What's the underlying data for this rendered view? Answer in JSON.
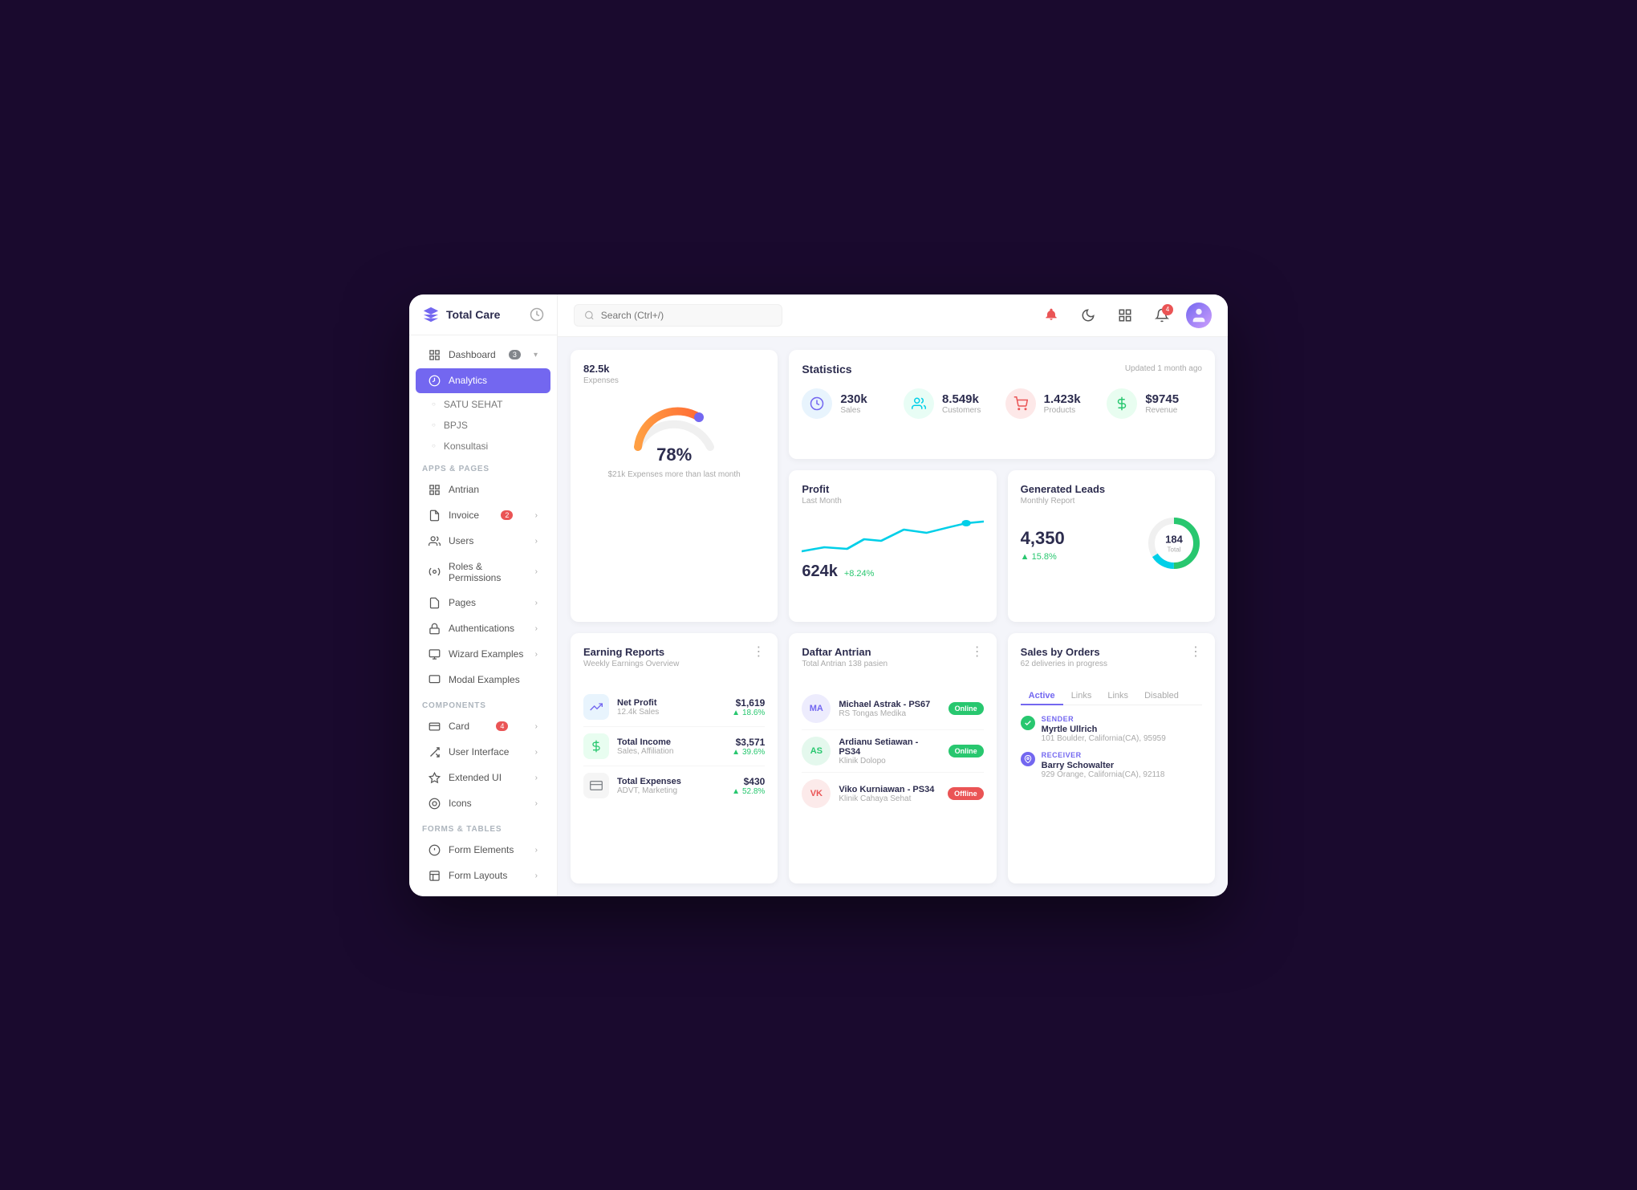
{
  "app": {
    "title": "Total Care",
    "search_placeholder": "Search (Ctrl+/)"
  },
  "sidebar": {
    "sections": [
      {
        "label": "",
        "items": [
          {
            "id": "dashboard",
            "label": "Dashboard",
            "icon": "home",
            "badge": "3",
            "badge_color": "gray",
            "has_arrow": true,
            "active": false
          },
          {
            "id": "analytics",
            "label": "Analytics",
            "icon": "bar-chart",
            "active": true
          },
          {
            "id": "satu-sehat",
            "label": "SATU SEHAT",
            "icon": "dot",
            "sub": true,
            "active": false
          },
          {
            "id": "bpjs",
            "label": "BPJS",
            "icon": "dot",
            "sub": true,
            "active": false
          },
          {
            "id": "konsultasi",
            "label": "Konsultasi",
            "icon": "dot",
            "sub": true,
            "active": false
          }
        ]
      },
      {
        "label": "APPS & PAGES",
        "items": [
          {
            "id": "antrian",
            "label": "Antrian",
            "icon": "grid",
            "active": false
          },
          {
            "id": "invoice",
            "label": "Invoice",
            "icon": "file",
            "badge": "2",
            "badge_color": "red",
            "has_arrow": true,
            "active": false
          },
          {
            "id": "users",
            "label": "Users",
            "icon": "users",
            "has_arrow": true,
            "active": false
          },
          {
            "id": "roles",
            "label": "Roles & Permissions",
            "icon": "gear",
            "has_arrow": true,
            "active": false
          },
          {
            "id": "pages",
            "label": "Pages",
            "icon": "pages",
            "has_arrow": true,
            "active": false
          },
          {
            "id": "auth",
            "label": "Authentications",
            "icon": "lock",
            "has_arrow": true,
            "active": false
          },
          {
            "id": "wizard",
            "label": "Wizard Examples",
            "icon": "wizard",
            "has_arrow": true,
            "active": false
          },
          {
            "id": "modal",
            "label": "Modal Examples",
            "icon": "modal",
            "active": false
          }
        ]
      },
      {
        "label": "COMPONENTS",
        "items": [
          {
            "id": "card",
            "label": "Card",
            "icon": "card",
            "badge": "4",
            "badge_color": "red",
            "has_arrow": true,
            "active": false
          },
          {
            "id": "ui",
            "label": "User Interface",
            "icon": "ui",
            "has_arrow": true,
            "active": false
          },
          {
            "id": "extended",
            "label": "Extended UI",
            "icon": "extended",
            "has_arrow": true,
            "active": false
          },
          {
            "id": "icons",
            "label": "Icons",
            "icon": "icons",
            "has_arrow": true,
            "active": false
          }
        ]
      },
      {
        "label": "FORMS & TABLES",
        "items": [
          {
            "id": "form-elements",
            "label": "Form Elements",
            "icon": "form",
            "has_arrow": true,
            "active": false
          },
          {
            "id": "form-layouts",
            "label": "Form Layouts",
            "icon": "layout",
            "has_arrow": true,
            "active": false
          }
        ]
      }
    ]
  },
  "header": {
    "notif_count": "4"
  },
  "statistics": {
    "title": "Statistics",
    "updated": "Updated 1 month ago",
    "items": [
      {
        "value": "230k",
        "label": "Sales",
        "color": "blue"
      },
      {
        "value": "8.549k",
        "label": "Customers",
        "color": "teal"
      },
      {
        "value": "1.423k",
        "label": "Products",
        "color": "red"
      },
      {
        "value": "$9745",
        "label": "Revenue",
        "color": "green"
      }
    ]
  },
  "expense": {
    "title": "82.5k",
    "subtitle": "Expenses",
    "percent": "78%",
    "note": "$21k Expenses more than last month"
  },
  "profit": {
    "title": "Profit",
    "subtitle": "Last Month",
    "value": "624k",
    "change": "+8.24%"
  },
  "leads": {
    "title": "Generated Leads",
    "subtitle": "Monthly Report",
    "value": "4,350",
    "change": "15.8%",
    "donut_total": "184",
    "donut_label": "Total"
  },
  "earning": {
    "title": "Earning Reports",
    "subtitle": "Weekly Earnings Overview",
    "items": [
      {
        "name": "Net Profit",
        "sub": "12.4k Sales",
        "amount": "$1,619",
        "change": "18.6%",
        "color": "blue"
      },
      {
        "name": "Total Income",
        "sub": "Sales, Affiliation",
        "amount": "$3,571",
        "change": "39.6%",
        "color": "green"
      },
      {
        "name": "Total Expenses",
        "sub": "ADVT, Marketing",
        "amount": "$430",
        "change": "52.8%",
        "color": "gray"
      }
    ]
  },
  "queue": {
    "title": "Daftar Antrian",
    "subtitle": "Total Antrian 138 pasien",
    "items": [
      {
        "name": "Michael Astrak - PS67",
        "place": "RS Tongas Medika",
        "status": "Online",
        "color_class": "status-online",
        "initials": "MA"
      },
      {
        "name": "Ardianu Setiawan - PS34",
        "place": "Klinik Dolopo",
        "status": "Online",
        "color_class": "status-online",
        "initials": "AS"
      },
      {
        "name": "Viko Kurniawan - PS34",
        "place": "Klinik Cahaya Sehat",
        "status": "Offline",
        "color_class": "status-offline",
        "initials": "VK"
      }
    ]
  },
  "sales": {
    "title": "Sales by Orders",
    "subtitle": "62 deliveries in progress",
    "tabs": [
      "Active",
      "Links",
      "Links",
      "Disabled"
    ],
    "active_tab": "Active",
    "sender": {
      "label": "SENDER",
      "name": "Myrtle Ullrich",
      "address": "101 Boulder, California(CA), 95959"
    },
    "receiver": {
      "label": "RECEIVER",
      "name": "Barry Schowalter",
      "address": "929 Orange, California(CA), 92118"
    }
  }
}
